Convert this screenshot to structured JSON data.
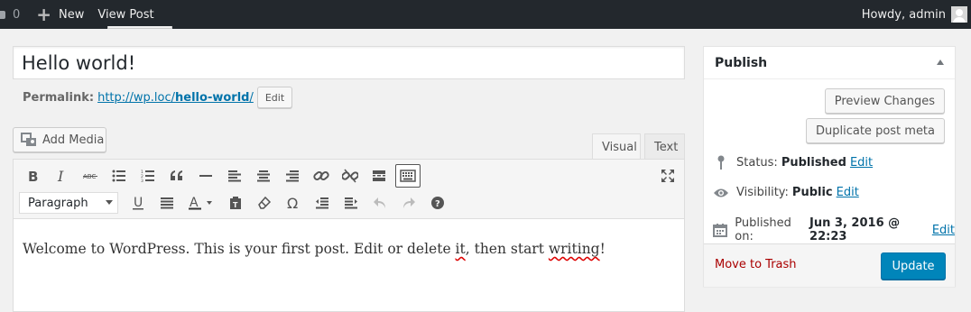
{
  "adminbar": {
    "comments_count": "0",
    "new_label": "New",
    "view_post_label": "View Post",
    "howdy_label": "Howdy, admin"
  },
  "post": {
    "title": "Hello world!",
    "permalink_label": "Permalink:",
    "permalink_base": "http://wp.loc/",
    "permalink_slug": "hello-world",
    "permalink_trail": "/",
    "edit_slug_label": "Edit"
  },
  "editor": {
    "add_media_label": "Add Media",
    "tab_visual": "Visual",
    "tab_text": "Text",
    "format_value": "Paragraph",
    "content": {
      "part1": "Welcome to WordPress. This is your first post. Edit or delete ",
      "spell1": "it",
      "part2": ", then start ",
      "spell2": "writing",
      "part3": "!"
    },
    "toolbar_row1": [
      "bold-icon",
      "italic-icon",
      "strikethrough-icon",
      "bullet-list-icon",
      "numbered-list-icon",
      "blockquote-icon",
      "horizontal-rule-icon",
      "align-left-icon",
      "align-center-icon",
      "align-right-icon",
      "link-icon",
      "unlink-icon",
      "read-more-icon",
      "toolbar-toggle-icon",
      "fullscreen-icon"
    ],
    "toolbar_row2": [
      "underline-icon",
      "justify-icon",
      "text-color-icon",
      "paste-text-icon",
      "clear-formatting-icon",
      "special-char-icon",
      "outdent-icon",
      "indent-icon",
      "undo-icon",
      "redo-icon",
      "help-icon"
    ]
  },
  "publish": {
    "heading": "Publish",
    "preview_label": "Preview Changes",
    "duplicate_label": "Duplicate post meta",
    "status_label": "Status:",
    "status_value": "Published",
    "visibility_label": "Visibility:",
    "visibility_value": "Public",
    "published_label": "Published on:",
    "published_value": "Jun 3, 2016 @ 22:23",
    "edit_label": "Edit",
    "trash_label": "Move to Trash",
    "update_label": "Update"
  },
  "colors": {
    "adminbar_bg": "#23282d",
    "link": "#0073aa",
    "primary_button": "#0085ba",
    "trash": "#aa0000"
  }
}
